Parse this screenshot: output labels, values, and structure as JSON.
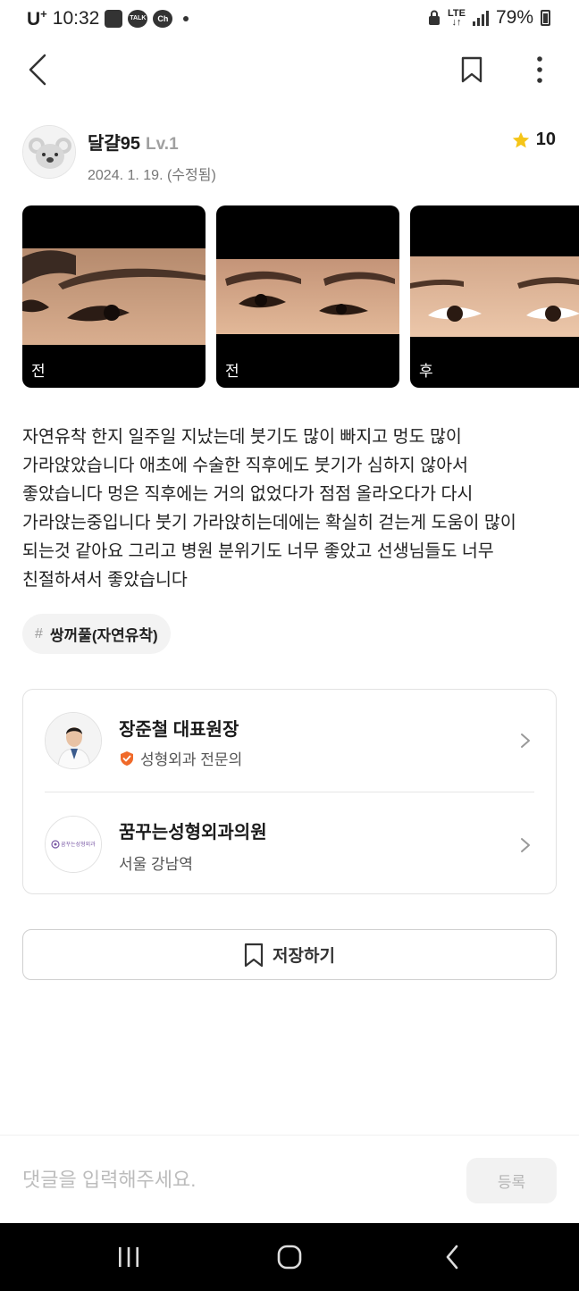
{
  "status_bar": {
    "carrier": "U",
    "carrier_sup": "+",
    "time": "10:32",
    "talk_label": "TALK",
    "ch_label": "Ch",
    "network": "LTE",
    "battery": "79%"
  },
  "nav": {
    "back_icon": "chevron-left-icon",
    "bookmark_icon": "bookmark-icon",
    "more_icon": "more-vertical-icon"
  },
  "author": {
    "name": "달걀95",
    "level": "Lv.1",
    "date": "2024. 1. 19. (수정됨)",
    "rating": "10",
    "rating_icon": "star-icon"
  },
  "photos": [
    {
      "label": "전"
    },
    {
      "label": "전"
    },
    {
      "label": "후"
    }
  ],
  "review_text": "자연유착 한지 일주일 지났는데 붓기도 많이 빠지고 멍도 많이\n가라앉았습니다 애초에 수술한 직후에도 붓기가 심하지 않아서\n좋았습니다 멍은 직후에는 거의 없었다가 점점 올라오다가 다시\n가라앉는중입니다 붓기 가라앉히는데에는 확실히 걷는게 도움이 많이\n되는것 같아요 그리고 병원 분위기도 너무 좋았고 선생님들도 너무\n친절하셔서 좋았습니다",
  "tag": {
    "hash": "#",
    "label": "쌍꺼풀(자연유착)"
  },
  "doctor": {
    "name": "장준철 대표원장",
    "badge": "성형외과 전문의"
  },
  "hospital": {
    "name": "꿈꾸는성형외과의원",
    "location": "서울 강남역",
    "logo_text": "꿈꾸는성형외과"
  },
  "save_button": {
    "label": "저장하기"
  },
  "comment": {
    "placeholder": "댓글을 입력해주세요.",
    "value": "",
    "submit_label": "등록"
  },
  "colors": {
    "star": "#f5c518",
    "badge": "#f06a2a",
    "accent_text": "#1b1b1b"
  }
}
